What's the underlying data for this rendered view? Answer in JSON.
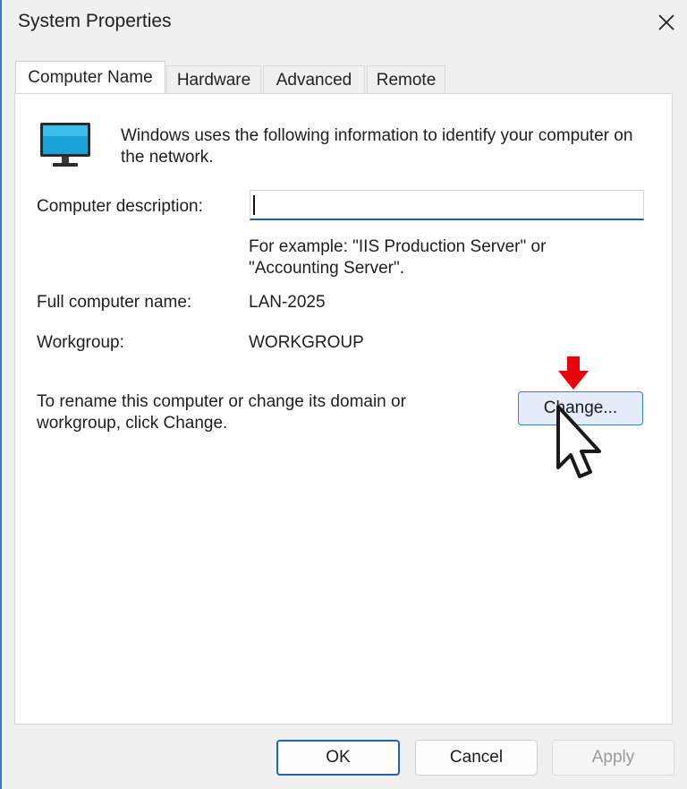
{
  "window": {
    "title": "System Properties",
    "close_icon": "close-icon"
  },
  "tabs": [
    {
      "label": "Computer Name",
      "active": true
    },
    {
      "label": "Hardware",
      "active": false
    },
    {
      "label": "Advanced",
      "active": false
    },
    {
      "label": "Remote",
      "active": false
    }
  ],
  "computer_name_tab": {
    "intro_icon": "monitor-icon",
    "intro_text": "Windows uses the following information to identify your computer on the network.",
    "description_label": "Computer description:",
    "description_value": "",
    "example_text": "For example: \"IIS Production Server\" or \"Accounting Server\".",
    "full_name_label": "Full computer name:",
    "full_name_value": "LAN-2025",
    "workgroup_label": "Workgroup:",
    "workgroup_value": "WORKGROUP",
    "rename_text": "To rename this computer or change its domain or workgroup, click Change.",
    "change_button": "Change..."
  },
  "footer": {
    "ok": "OK",
    "cancel": "Cancel",
    "apply": "Apply"
  },
  "annotations": {
    "arrow_icon": "red-down-arrow-icon",
    "cursor_icon": "mouse-pointer-icon",
    "arrow_color": "#e8000b"
  },
  "colors": {
    "accent": "#1f62b8",
    "monitor_screen": "#1aa3d8"
  }
}
